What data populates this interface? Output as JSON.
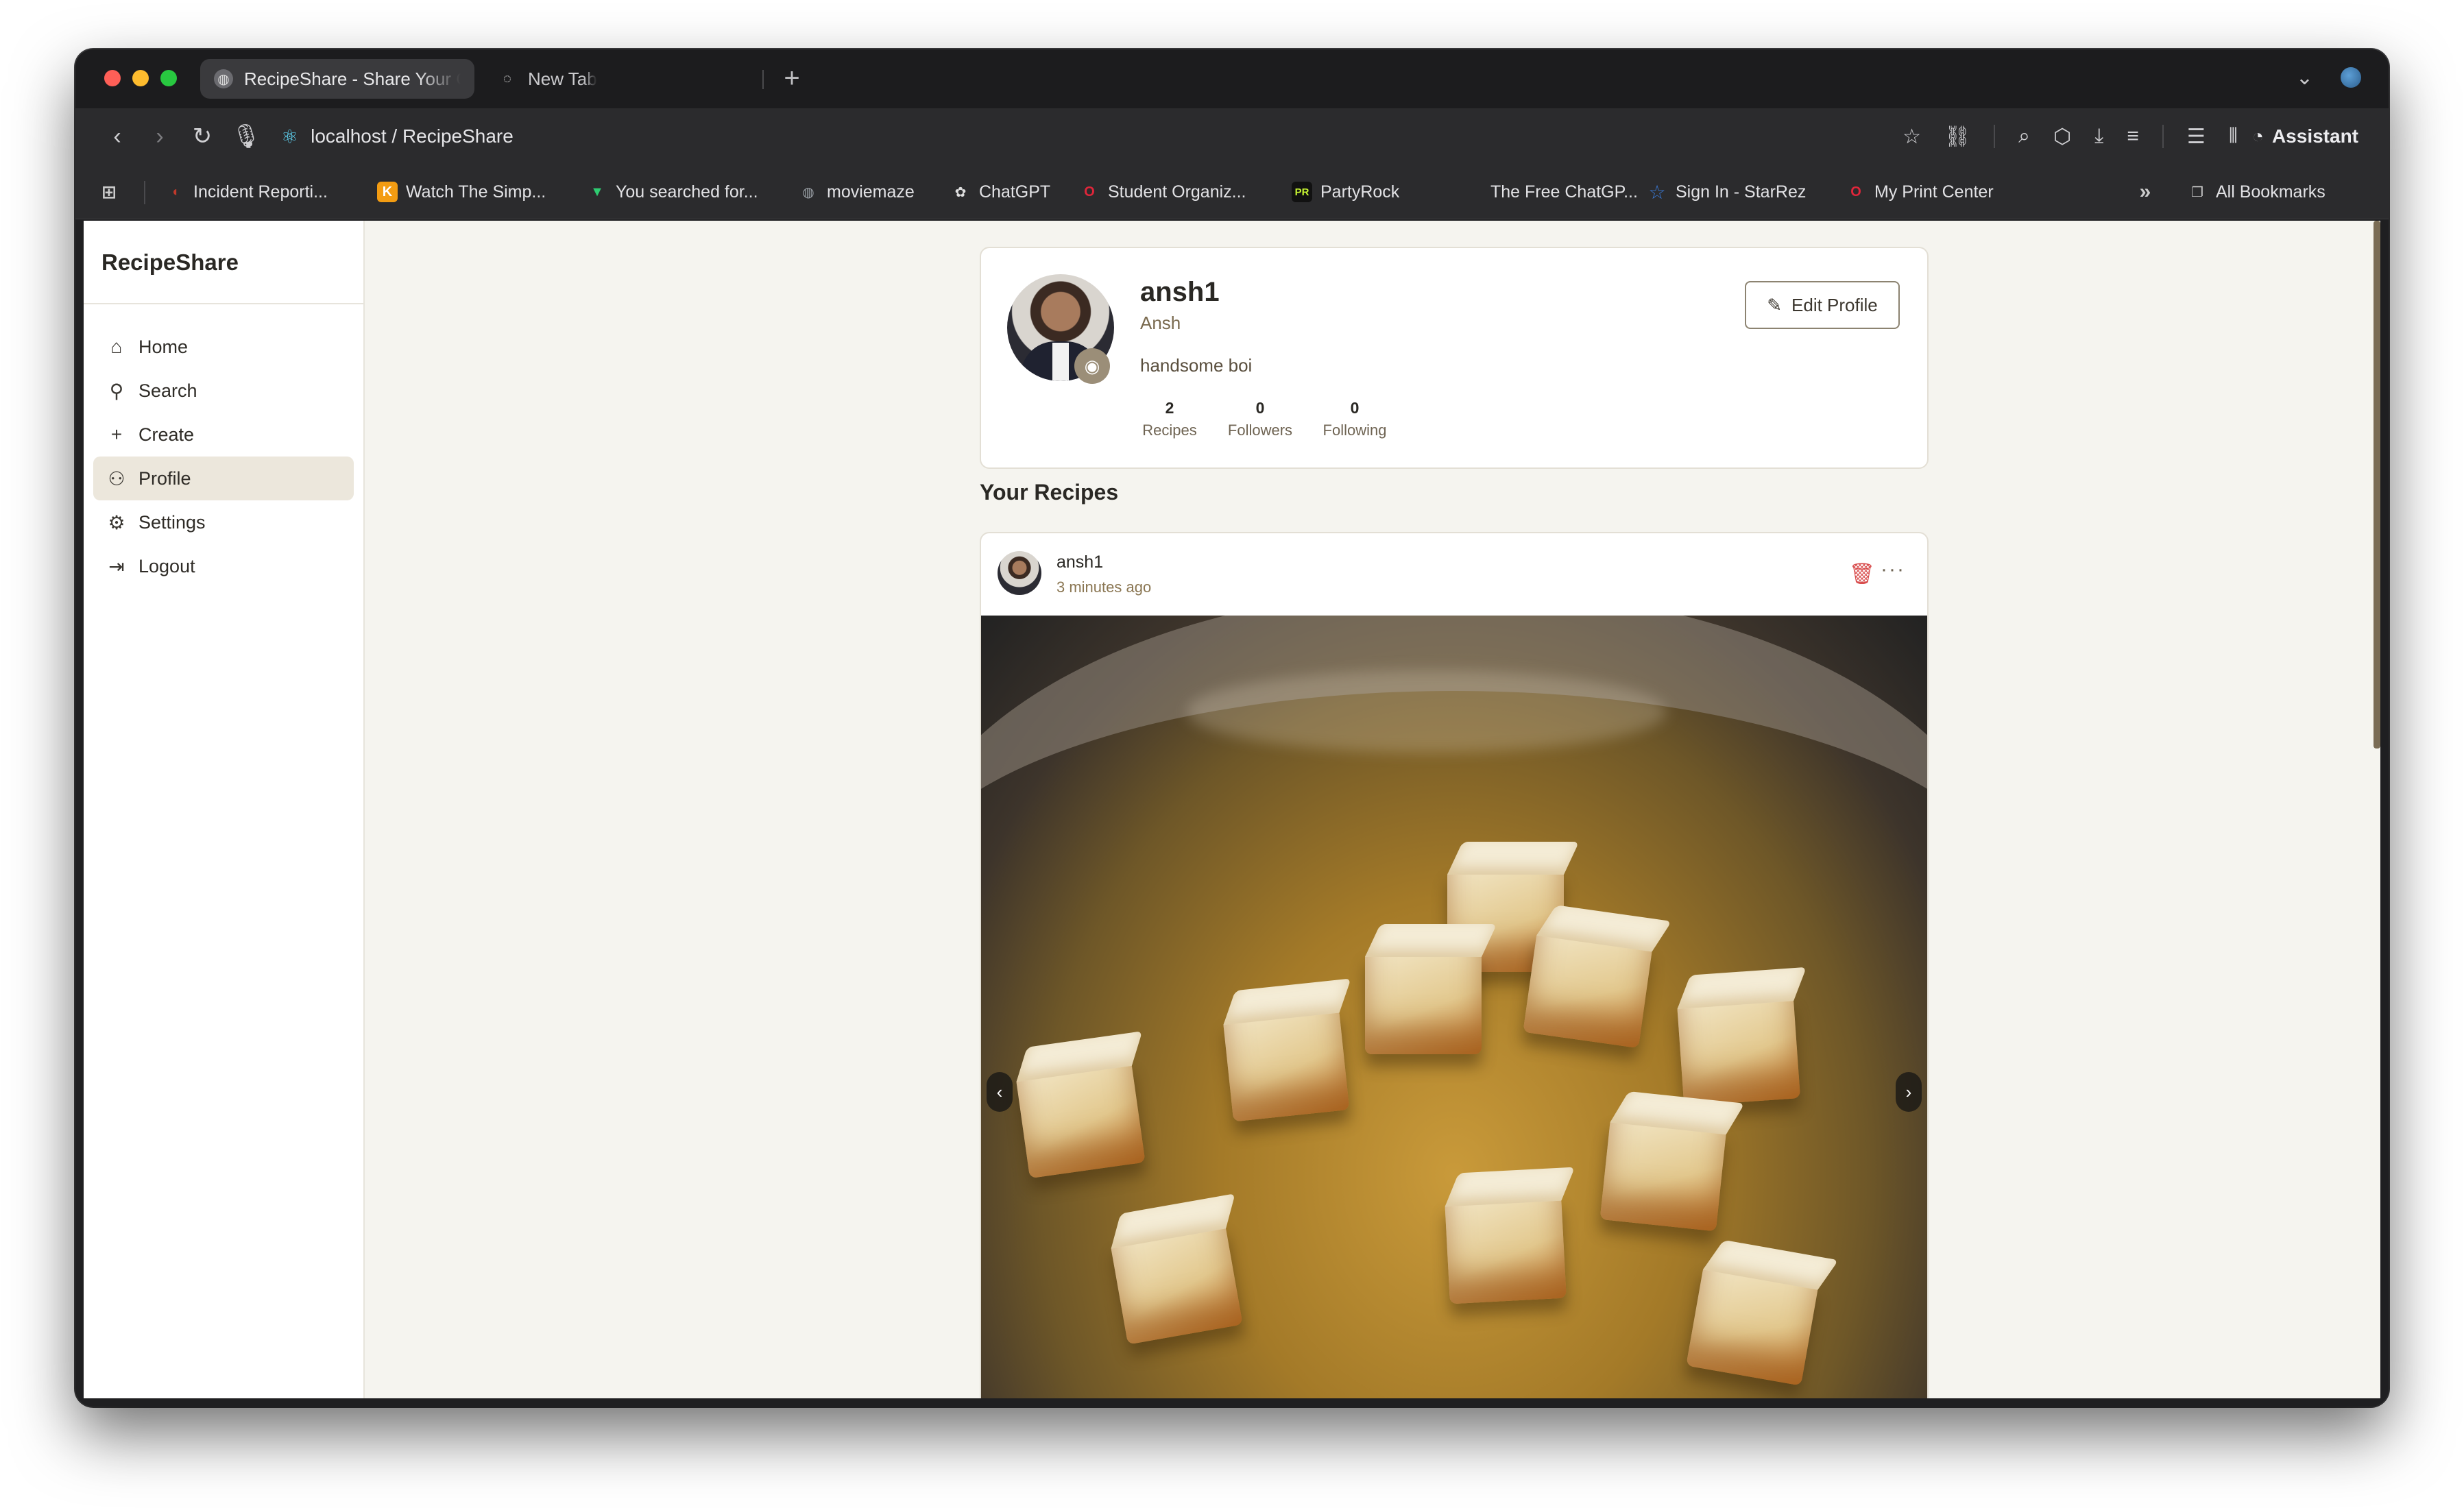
{
  "browser": {
    "tabs": [
      {
        "label": "RecipeShare - Share Your C",
        "active": true,
        "icon": "globe-icon"
      },
      {
        "label": "New Tab",
        "active": false,
        "icon": "perplexity-icon"
      }
    ],
    "url": "localhost / RecipeShare",
    "assistant_label": "Assistant",
    "bookmarks": [
      {
        "label": "Incident Reporti...",
        "icon": "incident-icon",
        "color": "#c0392b"
      },
      {
        "label": "Watch The Simp...",
        "icon": "k-icon",
        "color": "#f39c12"
      },
      {
        "label": "You searched for...",
        "icon": "v-icon",
        "color": "#2ecc71"
      },
      {
        "label": "moviemaze",
        "icon": "globe-icon",
        "color": "#9aa0a6"
      },
      {
        "label": "ChatGPT",
        "icon": "openai-icon",
        "color": "#e0e0e0"
      },
      {
        "label": "Student Organiz...",
        "icon": "opera-icon",
        "color": "#e0263a"
      },
      {
        "label": "PartyRock",
        "icon": "pr-icon",
        "color": "#c6f432"
      },
      {
        "label": "The Free ChatGP...",
        "icon": "blank-icon",
        "color": "#2b2b2d"
      },
      {
        "label": "Sign In - StarRez",
        "icon": "star-icon",
        "color": "#3b7ddd"
      },
      {
        "label": "My Print Center",
        "icon": "opera-icon",
        "color": "#e0263a"
      }
    ],
    "all_bookmarks_label": "All Bookmarks"
  },
  "app": {
    "brand": "RecipeShare",
    "nav": [
      {
        "label": "Home",
        "icon": "home-icon",
        "active": false
      },
      {
        "label": "Search",
        "icon": "search-icon",
        "active": false
      },
      {
        "label": "Create",
        "icon": "plus-icon",
        "active": false
      },
      {
        "label": "Profile",
        "icon": "user-icon",
        "active": true
      },
      {
        "label": "Settings",
        "icon": "gear-icon",
        "active": false
      },
      {
        "label": "Logout",
        "icon": "logout-icon",
        "active": false
      }
    ]
  },
  "profile": {
    "username": "ansh1",
    "full_name": "Ansh",
    "bio": "handsome boi",
    "edit_label": "Edit Profile",
    "stats": [
      {
        "value": "2",
        "label": "Recipes"
      },
      {
        "value": "0",
        "label": "Followers"
      },
      {
        "value": "0",
        "label": "Following"
      }
    ]
  },
  "recipes": {
    "section_title": "Your Recipes",
    "post": {
      "author": "ansh1",
      "time": "3 minutes ago"
    }
  },
  "colors": {
    "accent": "#7a6a4f",
    "page_bg": "#f5f4ef",
    "active_nav_bg": "#ece7dc",
    "delete": "#d84c4c"
  }
}
